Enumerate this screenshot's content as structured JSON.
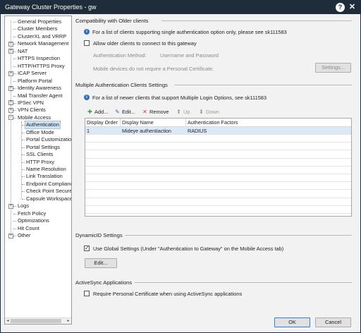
{
  "window": {
    "title": "Gateway Cluster Properties - gw",
    "help_label": "?",
    "close_label": "✕"
  },
  "tree": {
    "items": [
      {
        "label": "General Properties",
        "expander": ""
      },
      {
        "label": "Cluster Members",
        "expander": ""
      },
      {
        "label": "ClusterXL and VRRP",
        "expander": ""
      },
      {
        "label": "Network Management",
        "expander": "+"
      },
      {
        "label": "NAT",
        "expander": "+"
      },
      {
        "label": "HTTPS Inspection",
        "expander": ""
      },
      {
        "label": "HTTP/HTTPS Proxy",
        "expander": ""
      },
      {
        "label": "ICAP Server",
        "expander": "+"
      },
      {
        "label": "Platform Portal",
        "expander": ""
      },
      {
        "label": "Identity Awareness",
        "expander": "+"
      },
      {
        "label": "Mail Transfer Agent",
        "expander": ""
      },
      {
        "label": "IPSec VPN",
        "expander": "+"
      },
      {
        "label": "VPN Clients",
        "expander": "+"
      },
      {
        "label": "Mobile Access",
        "expander": "−"
      },
      {
        "label": "Authentication",
        "expander": "",
        "selected": true
      },
      {
        "label": "Office Mode",
        "expander": ""
      },
      {
        "label": "Portal Customization",
        "expander": ""
      },
      {
        "label": "Portal Settings",
        "expander": ""
      },
      {
        "label": "SSL Clients",
        "expander": ""
      },
      {
        "label": "HTTP Proxy",
        "expander": ""
      },
      {
        "label": "Name Resolution",
        "expander": ""
      },
      {
        "label": "Link Translation",
        "expander": ""
      },
      {
        "label": "Endpoint Compliance",
        "expander": ""
      },
      {
        "label": "Check Point Secure",
        "expander": ""
      },
      {
        "label": "Capsule Workspace",
        "expander": ""
      },
      {
        "label": "Logs",
        "expander": "+"
      },
      {
        "label": "Fetch Policy",
        "expander": ""
      },
      {
        "label": "Optimizations",
        "expander": ""
      },
      {
        "label": "Hit Count",
        "expander": ""
      },
      {
        "label": "Other",
        "expander": "+"
      }
    ]
  },
  "compat": {
    "title": "Compatibility with Older clients",
    "info": "For a list of clients supporting single authentication option only, please see sk111583",
    "allow_label": "Allow older clients to connect to this gateway",
    "allow_checked": false,
    "auth_method_label": "Authentication Method:",
    "auth_method_value": "Username and Password",
    "mobile_note": "Mobile devices do not require a Personal Certificate.",
    "settings_button": "Settings..."
  },
  "multi": {
    "title": "Multiple Authentication Clients Settings",
    "info": "For a list of newer clients that support Multiple Login Options, see sk111583",
    "toolbar": {
      "add": "Add...",
      "edit": "Edit...",
      "remove": "Remove",
      "up": "Up",
      "down": "Down"
    },
    "columns": [
      "Display Order",
      "Display Name",
      "Authentication Factors"
    ],
    "rows": [
      {
        "order": "1",
        "name": "Mideye authentiaction",
        "factors": "RADIUS"
      }
    ]
  },
  "dynamic": {
    "title": "DynamicID Settings",
    "use_global_label": "Use Global Settings (Under \"Authentication to Gateway\" on the Mobile Access tab)",
    "use_global_checked": true,
    "edit_button": "Edit..."
  },
  "activesync": {
    "title": "ActiveSync Applications",
    "require_label": "Require Personal Certificate when using ActiveSync applications",
    "require_checked": false
  },
  "footer": {
    "ok": "OK",
    "cancel": "Cancel"
  }
}
